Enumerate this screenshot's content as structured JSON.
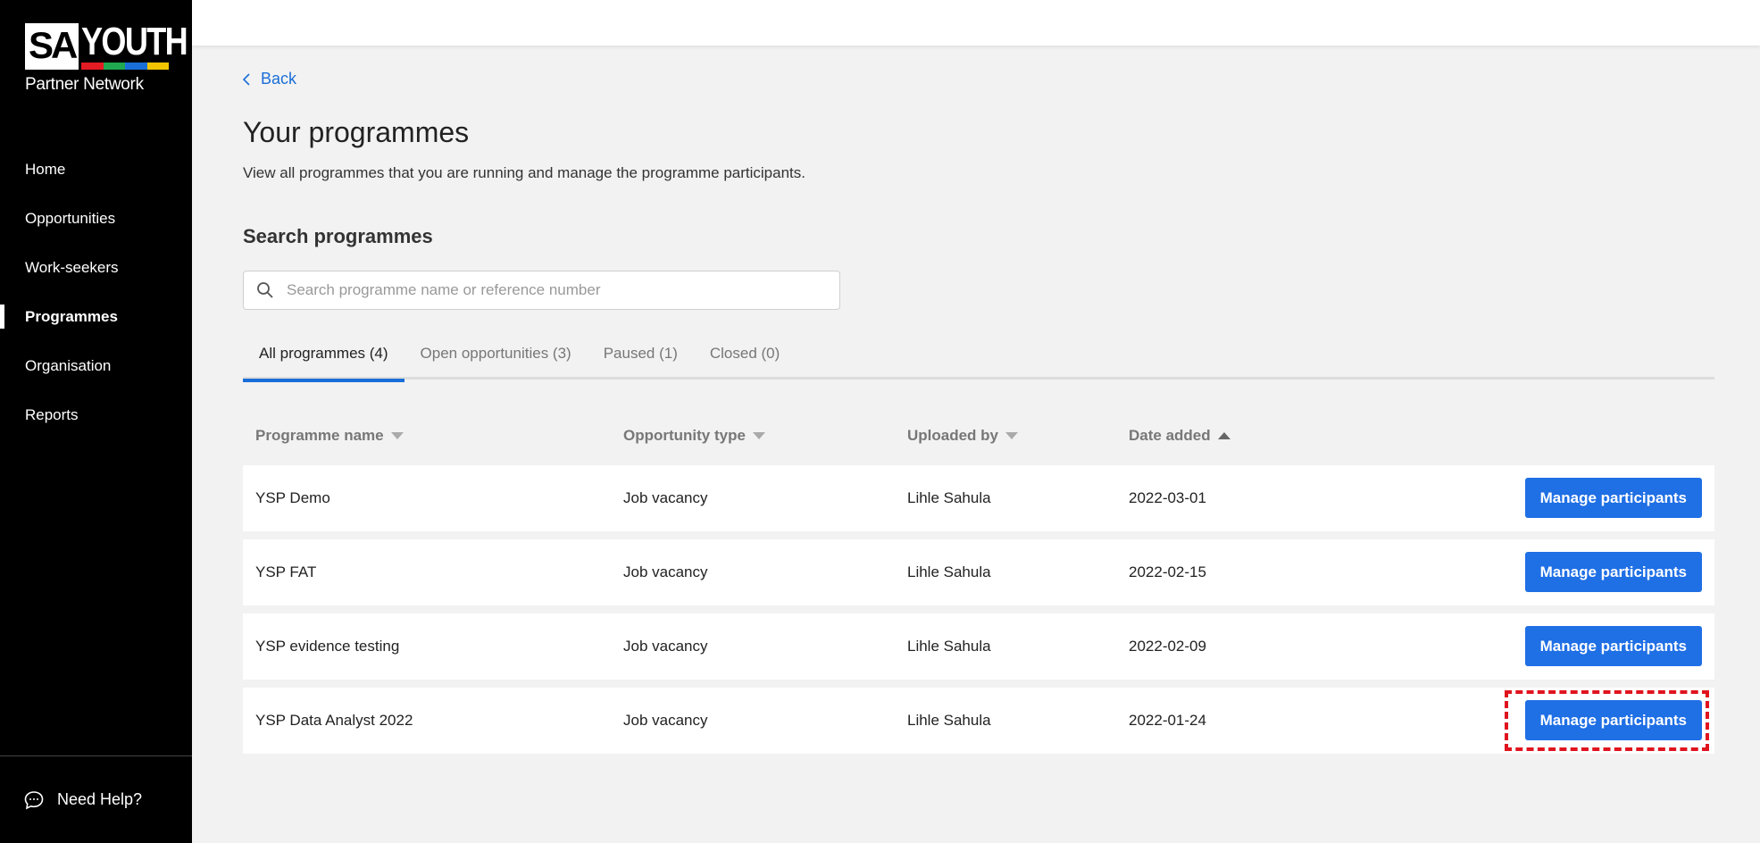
{
  "logo": {
    "sa": "SA",
    "youth": "YOUTH",
    "subtitle": "Partner Network",
    "stripe_colors": [
      "#e31b23",
      "#1fa84f",
      "#1a6ed8",
      "#f2c500"
    ]
  },
  "sidebar": {
    "items": [
      {
        "label": "Home",
        "active": false
      },
      {
        "label": "Opportunities",
        "active": false
      },
      {
        "label": "Work-seekers",
        "active": false
      },
      {
        "label": "Programmes",
        "active": true
      },
      {
        "label": "Organisation",
        "active": false
      },
      {
        "label": "Reports",
        "active": false
      }
    ],
    "help_label": "Need Help?"
  },
  "main": {
    "back_label": "Back",
    "title": "Your programmes",
    "description": "View all programmes that you are running and manage the programme participants.",
    "search_title": "Search programmes",
    "search_placeholder": "Search programme name or reference number",
    "tabs": [
      {
        "label": "All programmes (4)",
        "active": true
      },
      {
        "label": "Open opportunities (3)",
        "active": false
      },
      {
        "label": "Paused (1)",
        "active": false
      },
      {
        "label": "Closed (0)",
        "active": false
      }
    ],
    "table": {
      "columns": [
        "Programme name",
        "Opportunity type",
        "Uploaded by",
        "Date added"
      ],
      "rows": [
        {
          "name": "YSP Demo",
          "type": "Job vacancy",
          "uploaded_by": "Lihle Sahula",
          "date": "2022-03-01",
          "action": "Manage participants"
        },
        {
          "name": "YSP FAT",
          "type": "Job vacancy",
          "uploaded_by": "Lihle Sahula",
          "date": "2022-02-15",
          "action": "Manage participants"
        },
        {
          "name": "YSP evidence testing",
          "type": "Job vacancy",
          "uploaded_by": "Lihle Sahula",
          "date": "2022-02-09",
          "action": "Manage participants"
        },
        {
          "name": "YSP Data Analyst 2022",
          "type": "Job vacancy",
          "uploaded_by": "Lihle Sahula",
          "date": "2022-01-24",
          "action": "Manage participants"
        }
      ]
    }
  },
  "colors": {
    "accent": "#1f6fe5",
    "highlight": "#e0141e",
    "sidebar": "#000000"
  }
}
